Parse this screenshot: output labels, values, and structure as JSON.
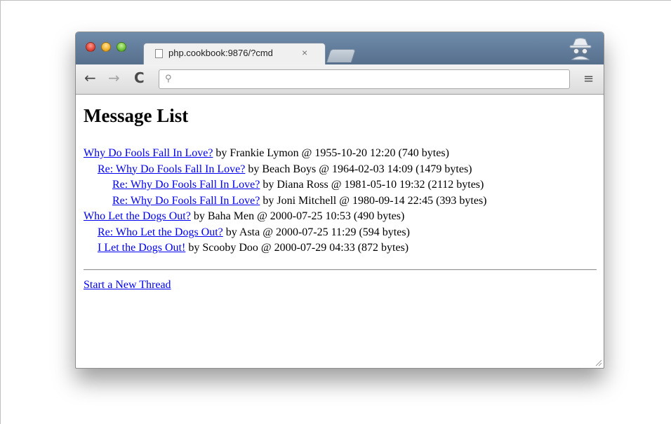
{
  "browser": {
    "tab_title": "php.cookbook:9876/?cmd",
    "tab_close": "×",
    "address": "",
    "back_icon": "←",
    "forward_icon": "→",
    "reload_icon": "C",
    "search_icon": "⚲",
    "menu_icon": "≡"
  },
  "page": {
    "title": "Message List",
    "messages": [
      {
        "subject": "Why Do Fools Fall In Love?",
        "meta": " by Frankie Lymon @ 1955-10-20 12:20 (740 bytes)",
        "level": 0
      },
      {
        "subject": "Re: Why Do Fools Fall In Love?",
        "meta": " by Beach Boys @ 1964-02-03 14:09 (1479 bytes)",
        "level": 1
      },
      {
        "subject": "Re: Why Do Fools Fall In Love?",
        "meta": " by Diana Ross @ 1981-05-10 19:32 (2112 bytes)",
        "level": 2
      },
      {
        "subject": "Re: Why Do Fools Fall In Love?",
        "meta": " by Joni Mitchell @ 1980-09-14 22:45 (393 bytes)",
        "level": 2
      },
      {
        "subject": "Who Let the Dogs Out?",
        "meta": " by Baha Men @ 2000-07-25 10:53 (490 bytes)",
        "level": 0
      },
      {
        "subject": "Re: Who Let the Dogs Out?",
        "meta": " by Asta @ 2000-07-25 11:29 (594 bytes)",
        "level": 1
      },
      {
        "subject": "I Let the Dogs Out!",
        "meta": " by Scooby Doo @ 2000-07-29 04:33 (872 bytes)",
        "level": 1
      }
    ],
    "new_thread_link": "Start a New Thread"
  }
}
